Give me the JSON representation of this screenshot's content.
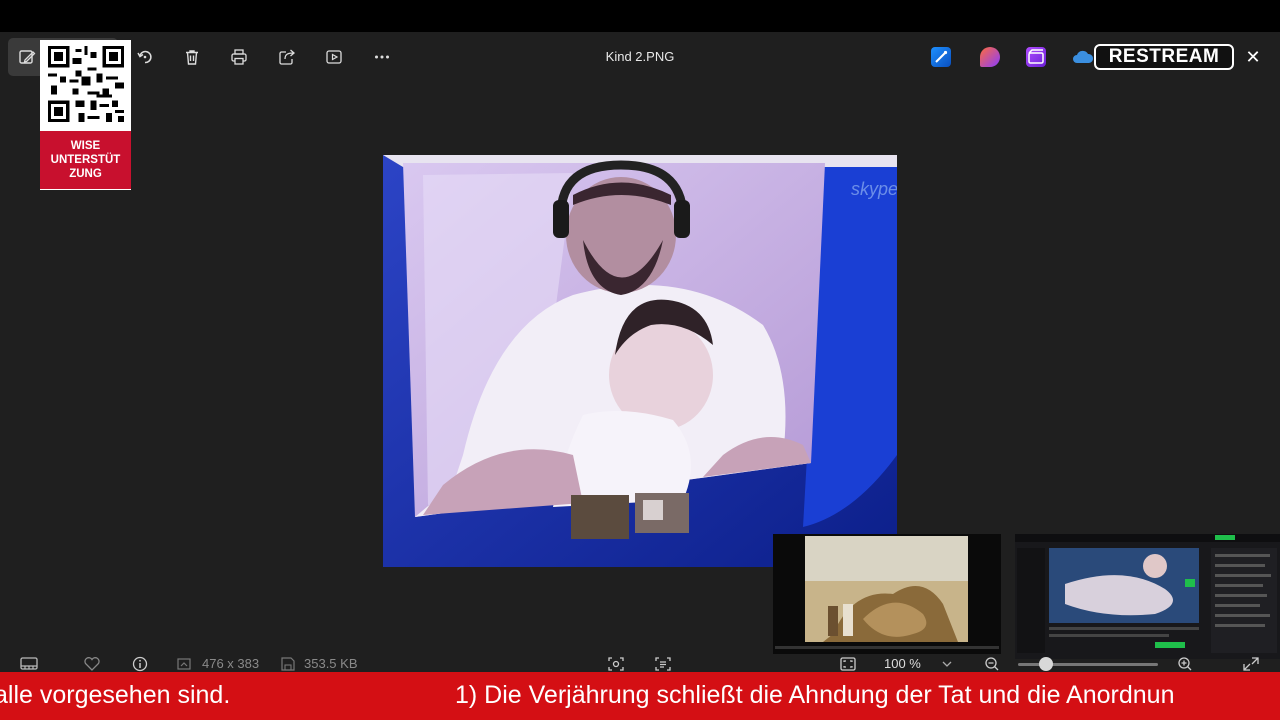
{
  "viewer": {
    "file_title": "Kind 2.PNG",
    "toolbar": {
      "edit_icon": "edit-image-icon",
      "rotate_icon": "rotate-icon",
      "delete_icon": "trash-icon",
      "print_icon": "printer-icon",
      "share_icon": "share-icon",
      "slideshow_icon": "play-icon",
      "more_icon": "more-icon"
    },
    "apps": [
      "app-icon-photos-edit",
      "app-icon-clipchamp-design",
      "app-icon-clipchamp"
    ],
    "status": {
      "dimensions": "476 x 383",
      "file_size": "353.5 KB",
      "zoom": "100 %",
      "zoom_level": 0.14
    }
  },
  "overlay": {
    "qr_caption": "WISE UNTERSTÜT ZUNG",
    "brand": "RESTREAM",
    "ticker_left": "alle vorgesehen sind.",
    "ticker_right": "1) Die Verjährung schließt die Ahndung der Tat und die Anordnun"
  },
  "colors": {
    "ticker_bg": "#d40f14",
    "viewer_bg": "#1f1f1f",
    "accent": "#0a84ff"
  }
}
